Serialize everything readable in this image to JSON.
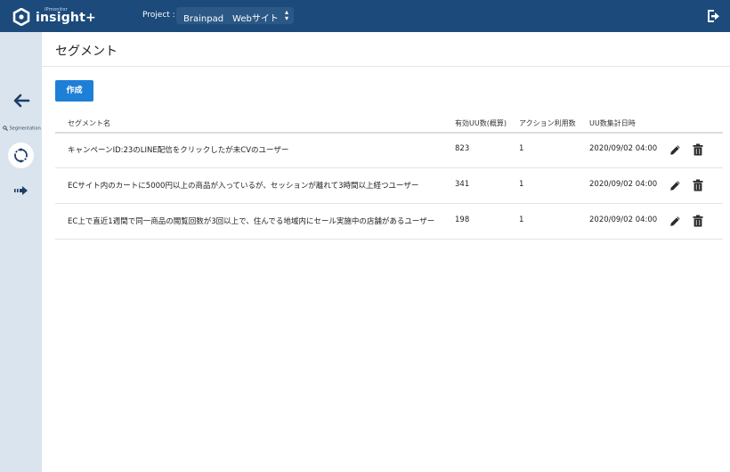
{
  "app": {
    "logo_small_text": "IPmonitor",
    "logo_text": "insight+",
    "project_label": "Project :",
    "project_value": "Brainpad　Webサイト"
  },
  "sidebar": {
    "segmentation_label": "Segmentation"
  },
  "page": {
    "title": "セグメント",
    "create_label": "作成"
  },
  "table": {
    "columns": [
      "セグメント名",
      "有効UU数(概算)",
      "アクション利用数",
      "UU数集計日時"
    ],
    "rows": [
      {
        "name": "キャンペーンID:23のLINE配信をクリックしたが未CVのユーザー",
        "uu": "823",
        "actions": "1",
        "date": "2020/09/02 04:00"
      },
      {
        "name": "ECサイト内のカートに5000円以上の商品が入っているが、セッションが離れて3時間以上経つユーザー",
        "uu": "341",
        "actions": "1",
        "date": "2020/09/02 04:00"
      },
      {
        "name": "EC上で直近1週間で同一商品の閲覧回数が3回以上で、住んでる地域内にセール実施中の店舗があるユーザー",
        "uu": "198",
        "actions": "1",
        "date": "2020/09/02 04:00"
      }
    ]
  },
  "colors": {
    "topbar": "#1b4a7b",
    "sidebar": "#d9e4ee",
    "primary_button": "#1e7fd6"
  },
  "icons": [
    "logo-icon",
    "updown-arrows-icon",
    "logout-icon",
    "back-arrow-icon",
    "magnifier-icon",
    "segment-cycle-icon",
    "forward-arrow-icon",
    "pencil-icon",
    "trash-icon"
  ]
}
